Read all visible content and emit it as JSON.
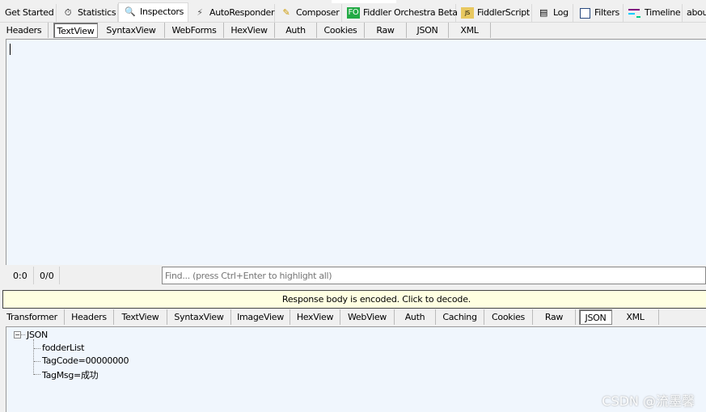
{
  "top_tabs": [
    {
      "label": "Get Started",
      "icon": ""
    },
    {
      "label": "Statistics",
      "icon": "stopwatch-icon"
    },
    {
      "label": "Inspectors",
      "icon": "magnifier-icon"
    },
    {
      "label": "AutoResponder",
      "icon": "lightning-icon"
    },
    {
      "label": "Composer",
      "icon": "pencil-icon"
    },
    {
      "label": "Fiddler Orchestra Beta",
      "icon": "fo-icon",
      "icon_text": "FO"
    },
    {
      "label": "FiddlerScript",
      "icon": "script-icon"
    },
    {
      "label": "Log",
      "icon": "document-icon"
    },
    {
      "label": "Filters",
      "icon": "checkbox-icon"
    },
    {
      "label": "Timeline",
      "icon": "timeline-icon"
    },
    {
      "label": "abou",
      "icon": ""
    }
  ],
  "selected_top_tab": "Inspectors",
  "request_tabs": [
    "Headers",
    "TextView",
    "SyntaxView",
    "WebForms",
    "HexView",
    "Auth",
    "Cookies",
    "Raw",
    "JSON",
    "XML"
  ],
  "selected_request_tab": "TextView",
  "status": {
    "position": "0:0",
    "matches": "0/0",
    "find_placeholder": "Find... (press Ctrl+Enter to highlight all)"
  },
  "banner": "Response body is encoded. Click to decode.",
  "response_tabs": [
    "Transformer",
    "Headers",
    "TextView",
    "SyntaxView",
    "ImageView",
    "HexView",
    "WebView",
    "Auth",
    "Caching",
    "Cookies",
    "Raw",
    "JSON",
    "XML"
  ],
  "selected_response_tab": "JSON",
  "tree": {
    "root": "JSON",
    "children": [
      "fodderList",
      "TagCode=00000000",
      "TagMsg=成功"
    ]
  },
  "watermark": "CSDN @流墨馨",
  "colors": {
    "editor_bg": "#f0f6fd",
    "banner_bg": "#ffffe1",
    "fo_green": "#22aa44"
  }
}
